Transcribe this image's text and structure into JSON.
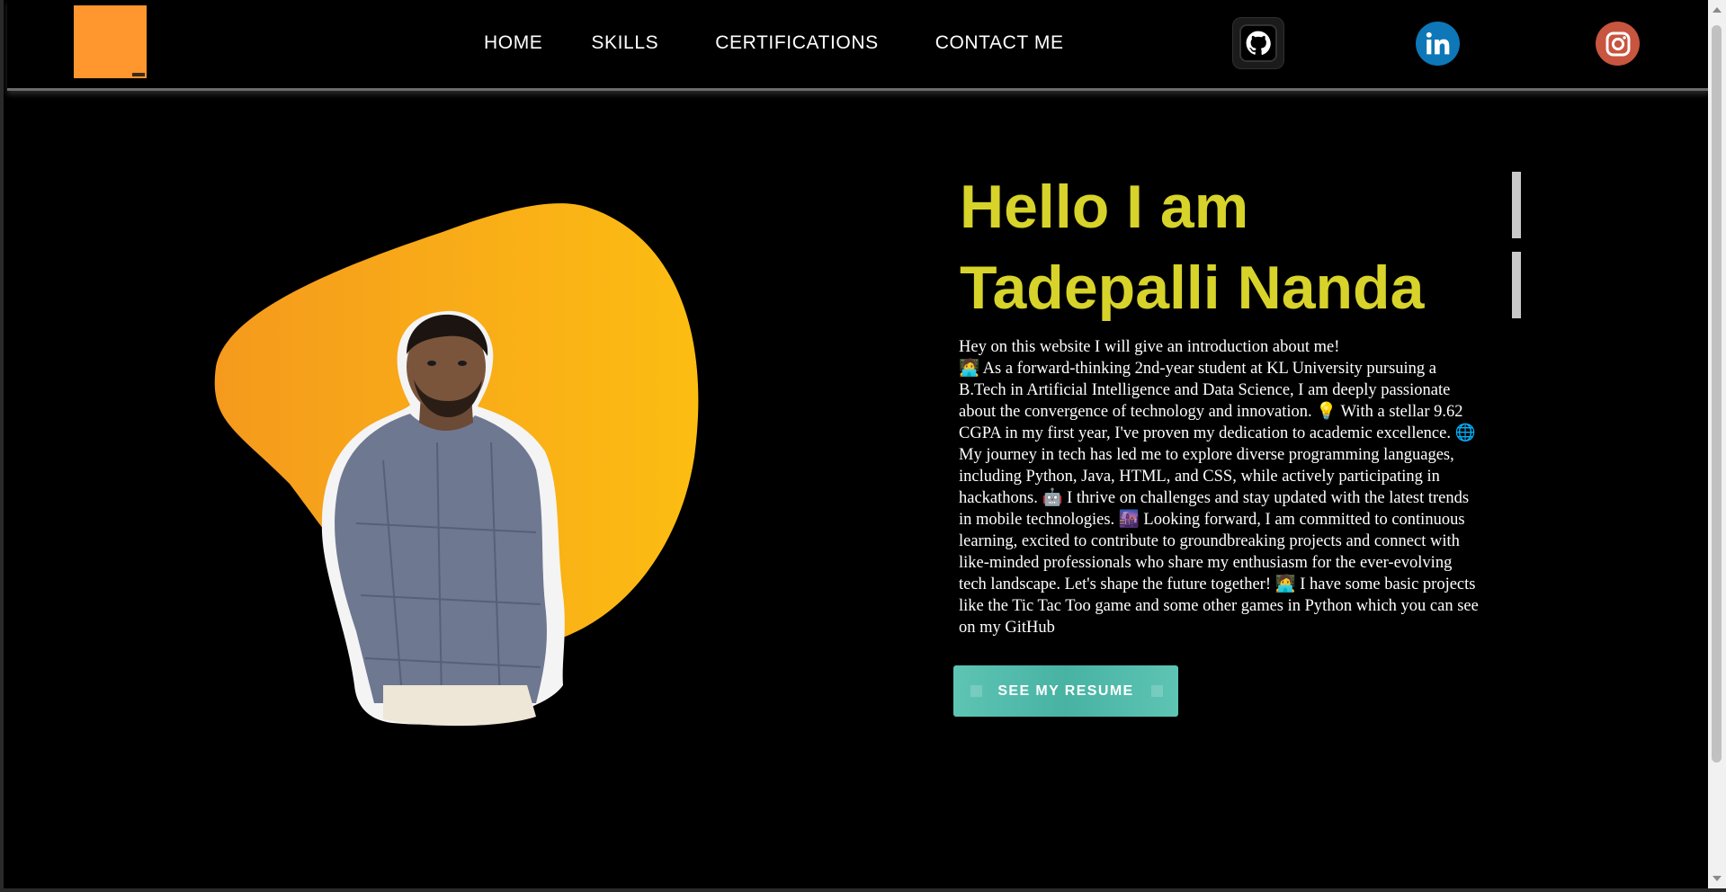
{
  "nav": {
    "links": [
      "HOME",
      "SKILLS",
      "CERTIFICATIONS",
      "CONTACT ME"
    ],
    "social": {
      "github_icon": "github-icon",
      "linkedin_icon": "linkedin-icon",
      "instagram_icon": "instagram-icon"
    }
  },
  "hero": {
    "headline_1": "Hello I am",
    "headline_2": "Tadepalli Nanda",
    "intro_lines": [
      "Hey on this website I will give an introduction about me!",
      "🧑‍💻 As a forward-thinking 2nd-year student at KL University pursuing a",
      "B.Tech in Artificial Intelligence and Data Science, I am deeply passionate",
      "about the convergence of technology and innovation. 💡 With a stellar 9.62",
      "CGPA in my first year, I've proven my dedication to academic excellence. 🌐",
      "My journey in tech has led me to explore diverse programming languages,",
      "including Python, Java, HTML, and CSS, while actively participating in",
      "hackathons. 🤖 I thrive on challenges and stay updated with the latest trends",
      "in mobile technologies. 🌆 Looking forward, I am committed to continuous",
      "learning, excited to contribute to groundbreaking projects and connect with",
      "like-minded professionals who share my enthusiasm for the ever-evolving",
      "tech landscape. Let's shape the future together! 🧑‍💻 I have some basic projects",
      "like the Tic Tac Too game and some other games in Python which you can see",
      "on my GitHub"
    ],
    "resume_button": "SEE MY RESUME"
  },
  "colors": {
    "accent_yellow": "#d7d32a",
    "logo_orange": "#ff962e",
    "button_teal": "#5ec4b4",
    "linkedin_blue": "#0e77b7",
    "instagram_rust": "#c8553f"
  }
}
